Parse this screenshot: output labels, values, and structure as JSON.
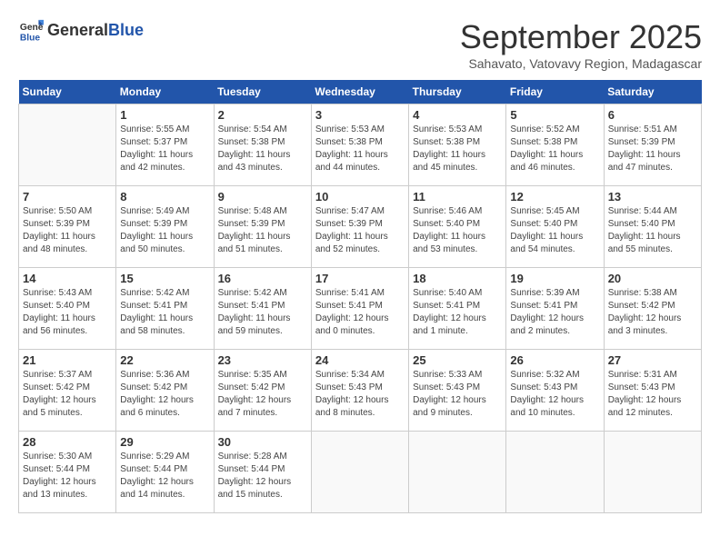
{
  "header": {
    "logo_line1": "General",
    "logo_line2": "Blue",
    "month": "September 2025",
    "location": "Sahavato, Vatovavy Region, Madagascar"
  },
  "days_of_week": [
    "Sunday",
    "Monday",
    "Tuesday",
    "Wednesday",
    "Thursday",
    "Friday",
    "Saturday"
  ],
  "weeks": [
    [
      {
        "date": "",
        "info": ""
      },
      {
        "date": "1",
        "info": "Sunrise: 5:55 AM\nSunset: 5:37 PM\nDaylight: 11 hours\nand 42 minutes."
      },
      {
        "date": "2",
        "info": "Sunrise: 5:54 AM\nSunset: 5:38 PM\nDaylight: 11 hours\nand 43 minutes."
      },
      {
        "date": "3",
        "info": "Sunrise: 5:53 AM\nSunset: 5:38 PM\nDaylight: 11 hours\nand 44 minutes."
      },
      {
        "date": "4",
        "info": "Sunrise: 5:53 AM\nSunset: 5:38 PM\nDaylight: 11 hours\nand 45 minutes."
      },
      {
        "date": "5",
        "info": "Sunrise: 5:52 AM\nSunset: 5:38 PM\nDaylight: 11 hours\nand 46 minutes."
      },
      {
        "date": "6",
        "info": "Sunrise: 5:51 AM\nSunset: 5:39 PM\nDaylight: 11 hours\nand 47 minutes."
      }
    ],
    [
      {
        "date": "7",
        "info": "Sunrise: 5:50 AM\nSunset: 5:39 PM\nDaylight: 11 hours\nand 48 minutes."
      },
      {
        "date": "8",
        "info": "Sunrise: 5:49 AM\nSunset: 5:39 PM\nDaylight: 11 hours\nand 50 minutes."
      },
      {
        "date": "9",
        "info": "Sunrise: 5:48 AM\nSunset: 5:39 PM\nDaylight: 11 hours\nand 51 minutes."
      },
      {
        "date": "10",
        "info": "Sunrise: 5:47 AM\nSunset: 5:39 PM\nDaylight: 11 hours\nand 52 minutes."
      },
      {
        "date": "11",
        "info": "Sunrise: 5:46 AM\nSunset: 5:40 PM\nDaylight: 11 hours\nand 53 minutes."
      },
      {
        "date": "12",
        "info": "Sunrise: 5:45 AM\nSunset: 5:40 PM\nDaylight: 11 hours\nand 54 minutes."
      },
      {
        "date": "13",
        "info": "Sunrise: 5:44 AM\nSunset: 5:40 PM\nDaylight: 11 hours\nand 55 minutes."
      }
    ],
    [
      {
        "date": "14",
        "info": "Sunrise: 5:43 AM\nSunset: 5:40 PM\nDaylight: 11 hours\nand 56 minutes."
      },
      {
        "date": "15",
        "info": "Sunrise: 5:42 AM\nSunset: 5:41 PM\nDaylight: 11 hours\nand 58 minutes."
      },
      {
        "date": "16",
        "info": "Sunrise: 5:42 AM\nSunset: 5:41 PM\nDaylight: 11 hours\nand 59 minutes."
      },
      {
        "date": "17",
        "info": "Sunrise: 5:41 AM\nSunset: 5:41 PM\nDaylight: 12 hours\nand 0 minutes."
      },
      {
        "date": "18",
        "info": "Sunrise: 5:40 AM\nSunset: 5:41 PM\nDaylight: 12 hours\nand 1 minute."
      },
      {
        "date": "19",
        "info": "Sunrise: 5:39 AM\nSunset: 5:41 PM\nDaylight: 12 hours\nand 2 minutes."
      },
      {
        "date": "20",
        "info": "Sunrise: 5:38 AM\nSunset: 5:42 PM\nDaylight: 12 hours\nand 3 minutes."
      }
    ],
    [
      {
        "date": "21",
        "info": "Sunrise: 5:37 AM\nSunset: 5:42 PM\nDaylight: 12 hours\nand 5 minutes."
      },
      {
        "date": "22",
        "info": "Sunrise: 5:36 AM\nSunset: 5:42 PM\nDaylight: 12 hours\nand 6 minutes."
      },
      {
        "date": "23",
        "info": "Sunrise: 5:35 AM\nSunset: 5:42 PM\nDaylight: 12 hours\nand 7 minutes."
      },
      {
        "date": "24",
        "info": "Sunrise: 5:34 AM\nSunset: 5:43 PM\nDaylight: 12 hours\nand 8 minutes."
      },
      {
        "date": "25",
        "info": "Sunrise: 5:33 AM\nSunset: 5:43 PM\nDaylight: 12 hours\nand 9 minutes."
      },
      {
        "date": "26",
        "info": "Sunrise: 5:32 AM\nSunset: 5:43 PM\nDaylight: 12 hours\nand 10 minutes."
      },
      {
        "date": "27",
        "info": "Sunrise: 5:31 AM\nSunset: 5:43 PM\nDaylight: 12 hours\nand 12 minutes."
      }
    ],
    [
      {
        "date": "28",
        "info": "Sunrise: 5:30 AM\nSunset: 5:44 PM\nDaylight: 12 hours\nand 13 minutes."
      },
      {
        "date": "29",
        "info": "Sunrise: 5:29 AM\nSunset: 5:44 PM\nDaylight: 12 hours\nand 14 minutes."
      },
      {
        "date": "30",
        "info": "Sunrise: 5:28 AM\nSunset: 5:44 PM\nDaylight: 12 hours\nand 15 minutes."
      },
      {
        "date": "",
        "info": ""
      },
      {
        "date": "",
        "info": ""
      },
      {
        "date": "",
        "info": ""
      },
      {
        "date": "",
        "info": ""
      }
    ]
  ]
}
